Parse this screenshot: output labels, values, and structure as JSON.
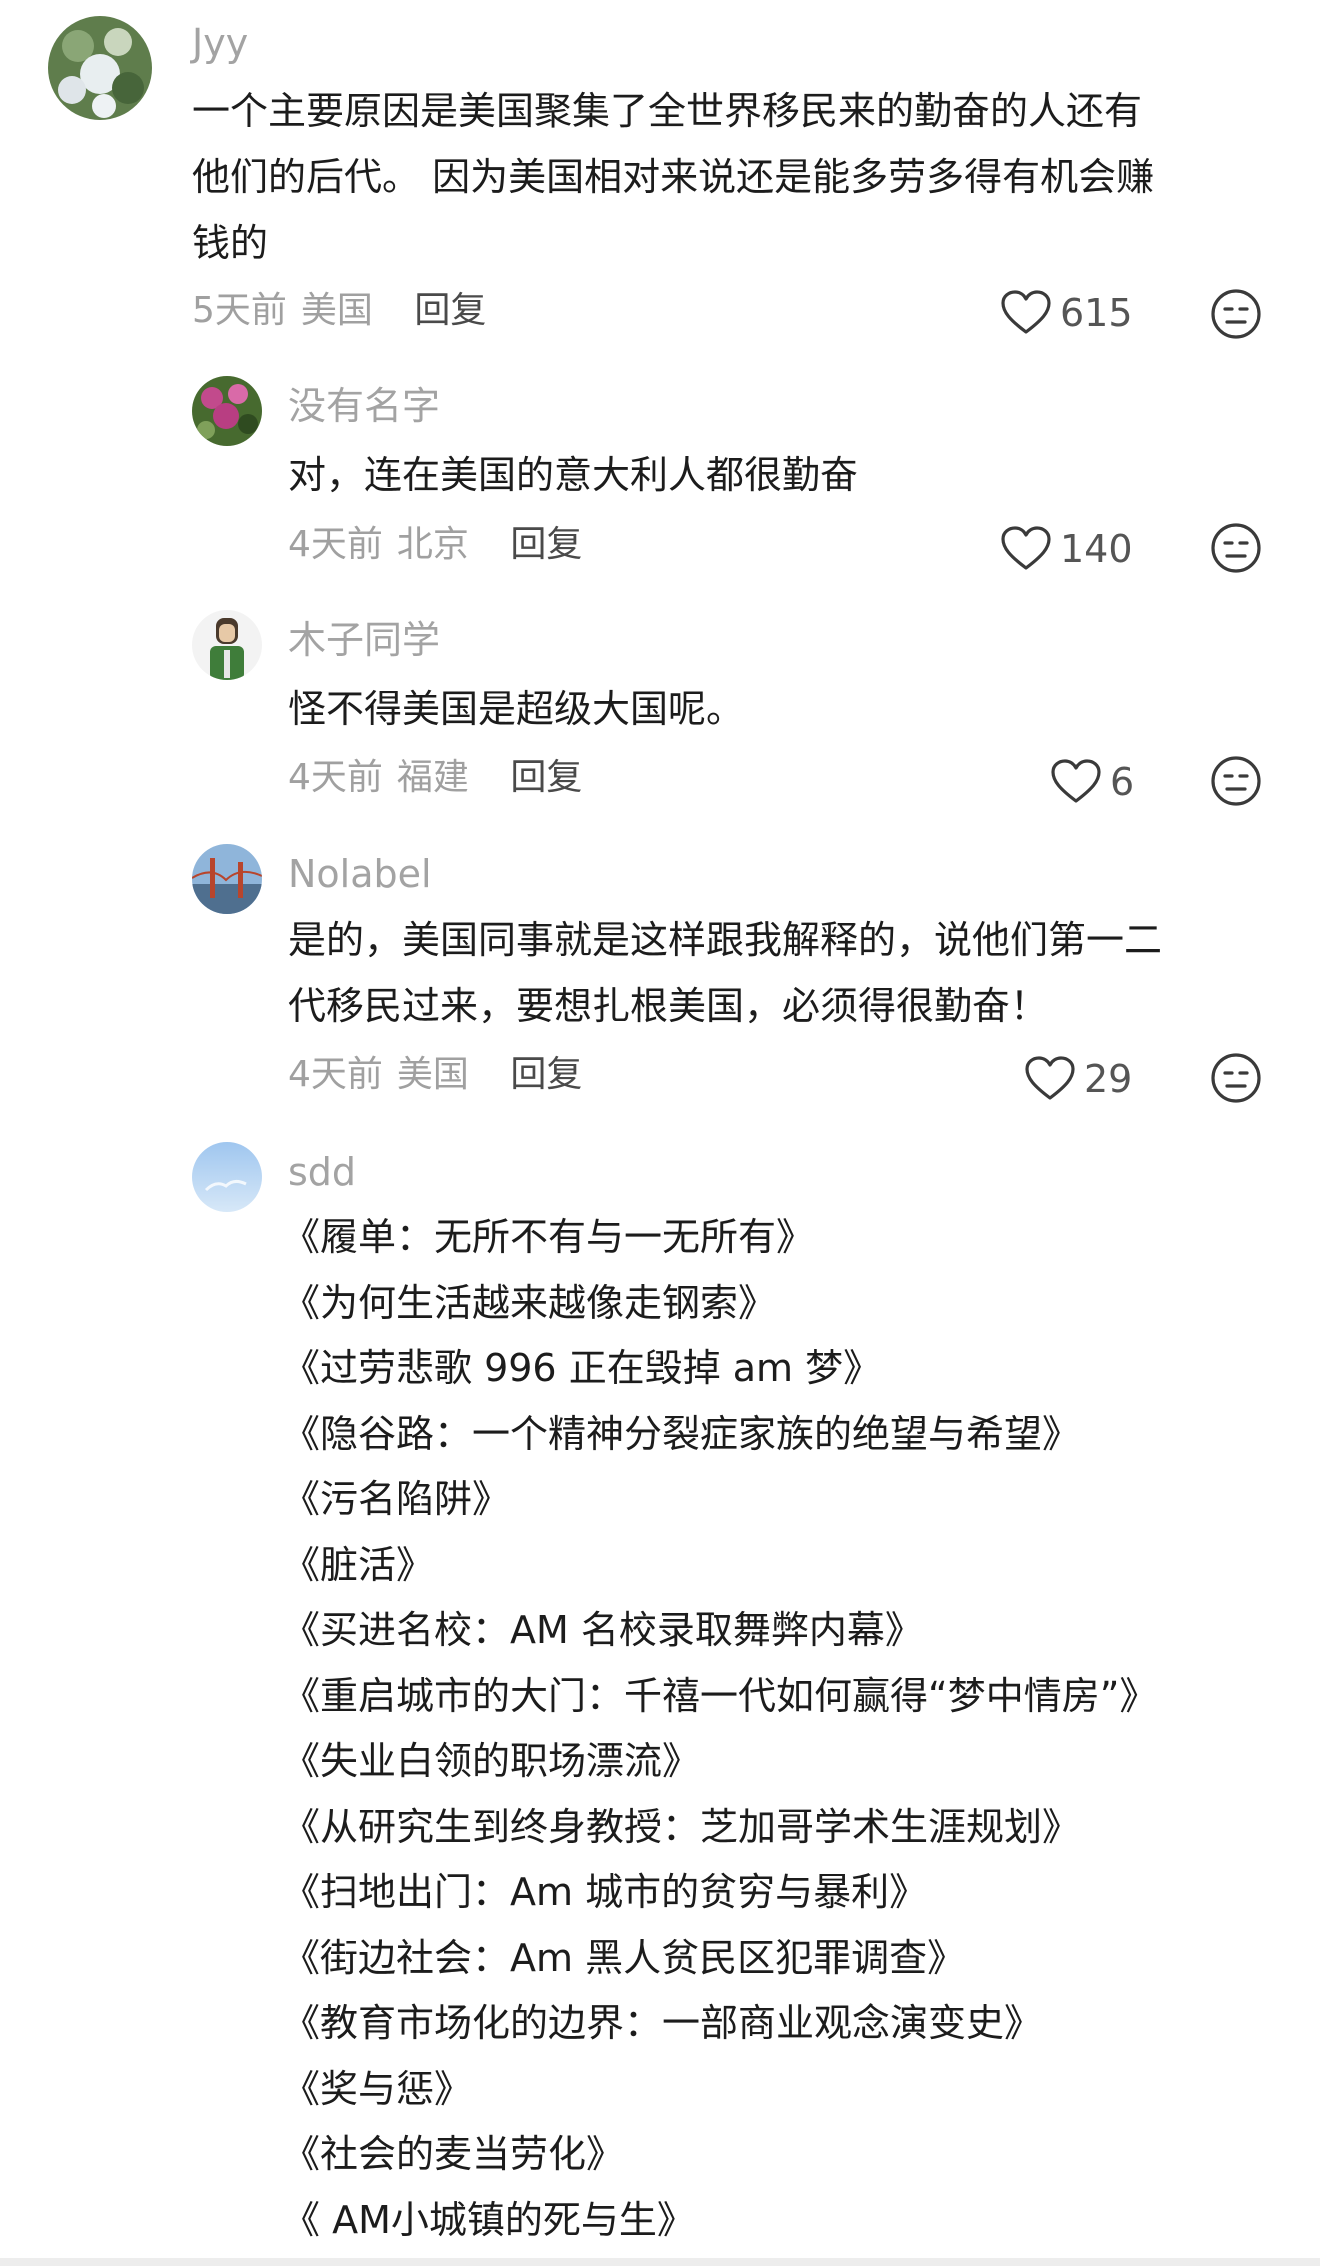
{
  "comments": [
    {
      "username": "Jyy",
      "lines": [
        "一个主要原因是美国聚集了全世界移民来的勤奋的人还有",
        "他们的后代。 因为美国相对来说还是能多劳多得有机会赚",
        "钱的"
      ],
      "time": "5天前",
      "location": "美国",
      "reply": "回复",
      "likes": "615"
    },
    {
      "username": "没有名字",
      "lines": [
        "对，连在美国的意大利人都很勤奋"
      ],
      "time": "4天前",
      "location": "北京",
      "reply": "回复",
      "likes": "140"
    },
    {
      "username": "木子同学",
      "lines": [
        "怪不得美国是超级大国呢。"
      ],
      "time": "4天前",
      "location": "福建",
      "reply": "回复",
      "likes": "6"
    },
    {
      "username": "Nolabel",
      "lines": [
        "是的，美国同事就是这样跟我解释的，说他们第一二",
        "代移民过来，要想扎根美国，必须得很勤奋！"
      ],
      "time": "4天前",
      "location": "美国",
      "reply": "回复",
      "likes": "29"
    },
    {
      "username": "sdd",
      "lines": [
        "《履单：无所不有与一无所有》",
        "《为何生活越来越像走钢索》",
        "《过劳悲歌 996 正在毁掉 am 梦》",
        "《隐谷路：一个精神分裂症家族的绝望与希望》",
        "《污名陷阱》",
        "《脏活》",
        "《买进名校：AM 名校录取舞弊内幕》",
        "《重启城市的大门：千禧一代如何赢得“梦中情房”》",
        "《失业白领的职场漂流》",
        "《从研究生到终身教授：芝加哥学术生涯规划》",
        "《扫地出门：Am 城市的贫穷与暴利》",
        "《街边社会：Am 黑人贫民区犯罪调查》",
        "《教育市场化的边界：一部商业观念演变史》",
        "《奖与惩》",
        "《社会的麦当劳化》",
        "《 AM小城镇的死与生》"
      ]
    }
  ],
  "colors": {
    "username": "#a3a3a3",
    "meta": "#a0a0a0",
    "text": "#1c1c1c",
    "icon": "#3a3a3a"
  },
  "icons": {
    "like": "heart-outline-icon",
    "dislike": "meh-face-icon"
  }
}
